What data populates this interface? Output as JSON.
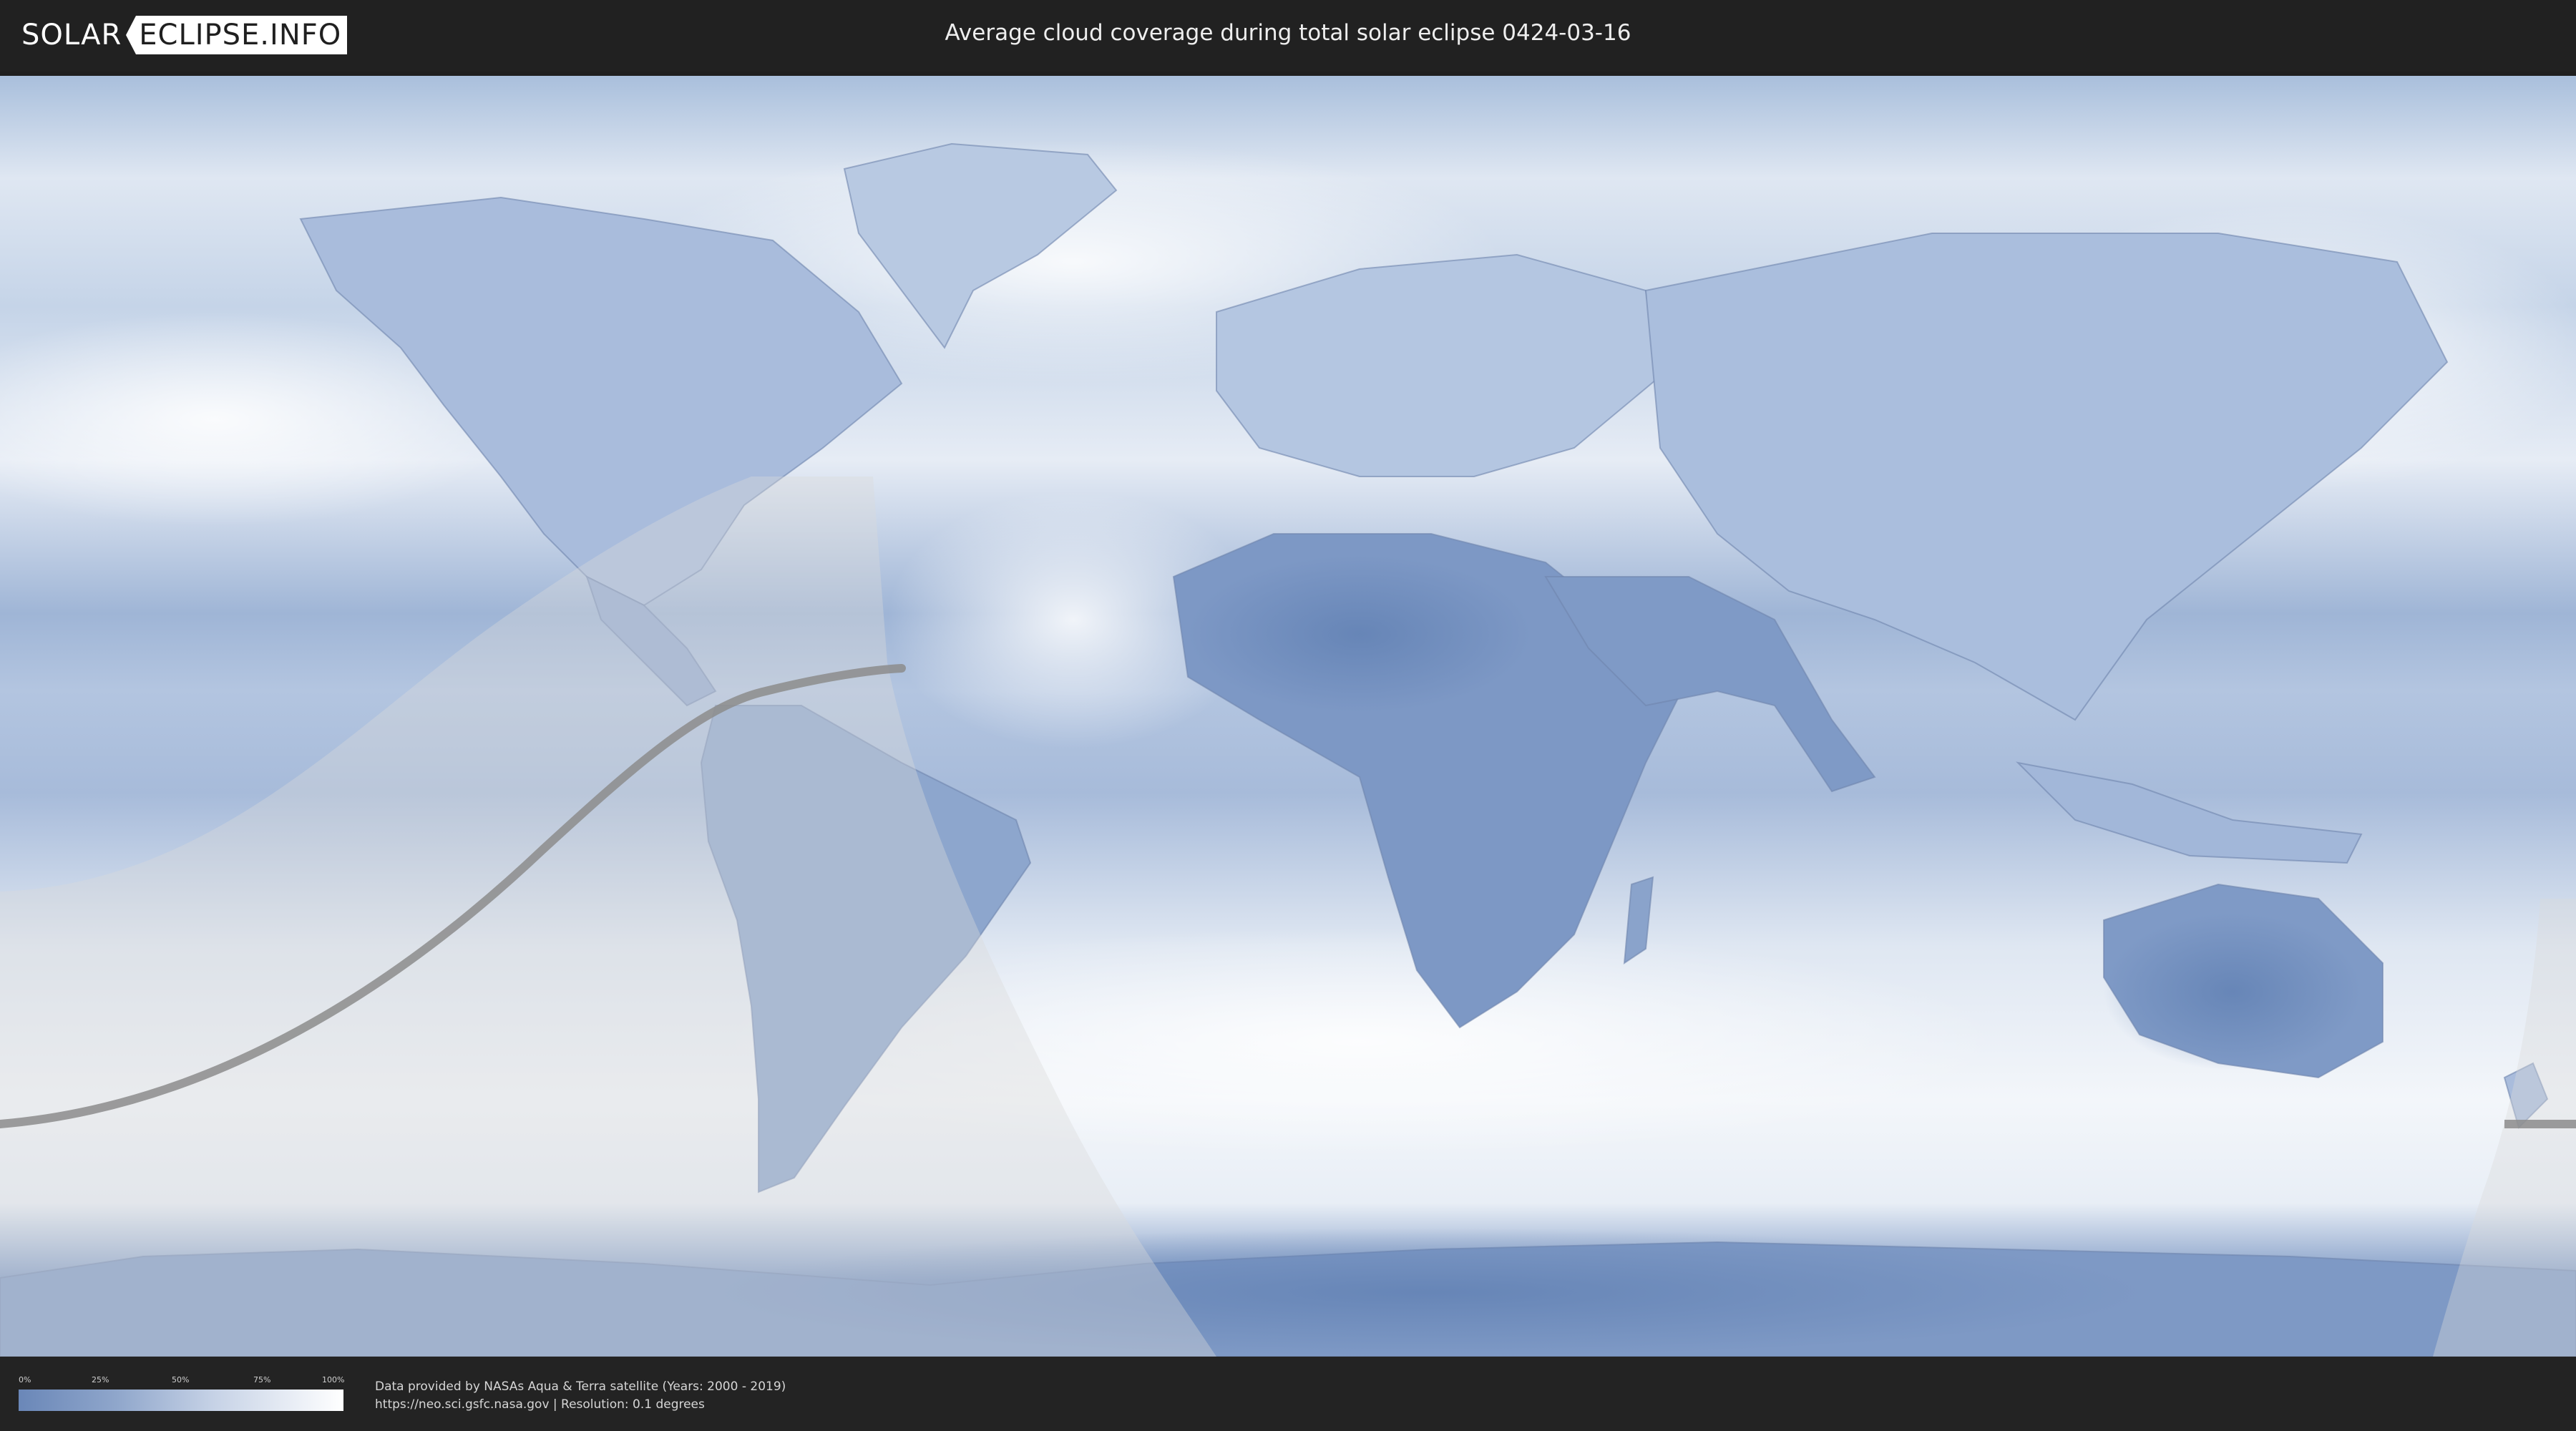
{
  "header": {
    "logo_left": "SOLAR",
    "logo_right": "ECLIPSE.INFO",
    "title": "Average cloud coverage during total solar eclipse 0424-03-16"
  },
  "legend": {
    "ticks": [
      "0%",
      "25%",
      "50%",
      "75%",
      "100%"
    ],
    "min_color": "#6a87b8",
    "max_color": "#ffffff"
  },
  "credits": {
    "line1": "Data provided by NASAs Aqua & Terra satellite (Years: 2000 - 2019)",
    "line2": "https://neo.sci.gsfc.nasa.gov | Resolution: 0.1 degrees"
  },
  "colors": {
    "header_bg": "#212121",
    "map_low_cloud": "#6e8fbe",
    "map_high_cloud": "#f2f5fa",
    "eclipse_path": "#8c8c8c",
    "penumbra_overlay": "#d9d9d9"
  }
}
